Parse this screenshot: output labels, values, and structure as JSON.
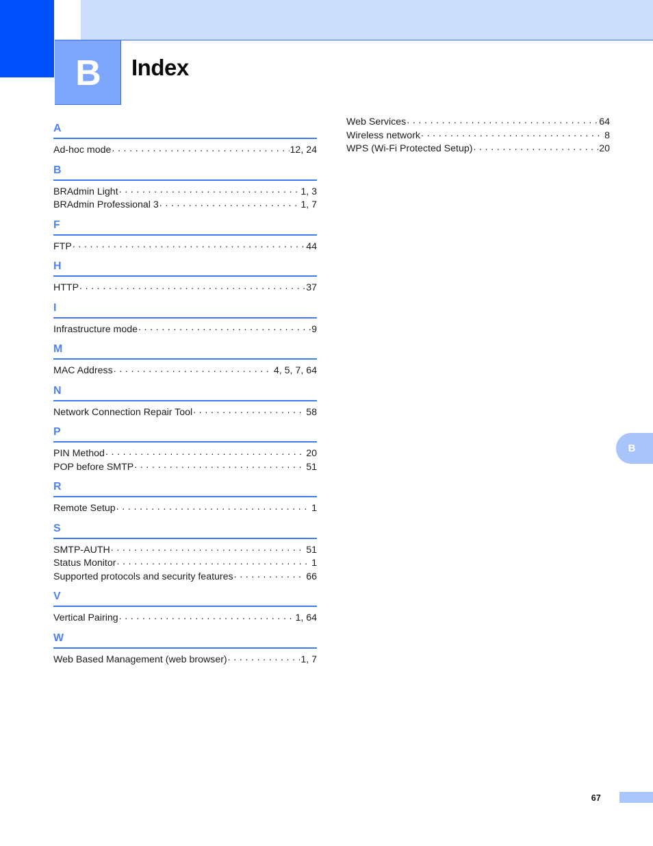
{
  "header": {
    "chapter_letter": "B",
    "title": "Index",
    "colors": {
      "dark_blue": "#0050fc",
      "light_blue": "#ccdcfb",
      "chapter_box_blue": "#7ea7fb",
      "rule_blue": "#3f79f2",
      "letter_blue": "#4d82f3",
      "tab_blue": "#a9c4fb"
    }
  },
  "side_tab": {
    "label": "B"
  },
  "footer": {
    "page_number": "67"
  },
  "columns": {
    "left": [
      {
        "letter": "A",
        "entries": [
          {
            "title": "Ad-hoc mode",
            "pages": "12, 24"
          }
        ]
      },
      {
        "letter": "B",
        "entries": [
          {
            "title": "BRAdmin Light",
            "pages": "1, 3"
          },
          {
            "title": "BRAdmin Professional 3",
            "pages": "1, 7"
          }
        ]
      },
      {
        "letter": "F",
        "entries": [
          {
            "title": "FTP",
            "pages": "44"
          }
        ]
      },
      {
        "letter": "H",
        "entries": [
          {
            "title": "HTTP",
            "pages": "37"
          }
        ]
      },
      {
        "letter": "I",
        "entries": [
          {
            "title": "Infrastructure mode",
            "pages": "9"
          }
        ]
      },
      {
        "letter": "M",
        "entries": [
          {
            "title": "MAC Address",
            "pages": "4, 5, 7, 64"
          }
        ]
      },
      {
        "letter": "N",
        "entries": [
          {
            "title": "Network Connection Repair Tool",
            "pages": "58"
          }
        ]
      },
      {
        "letter": "P",
        "entries": [
          {
            "title": "PIN Method",
            "pages": "20"
          },
          {
            "title": "POP before SMTP",
            "pages": "51"
          }
        ]
      },
      {
        "letter": "R",
        "entries": [
          {
            "title": "Remote Setup",
            "pages": "1"
          }
        ]
      },
      {
        "letter": "S",
        "entries": [
          {
            "title": "SMTP-AUTH",
            "pages": "51"
          },
          {
            "title": "Status Monitor",
            "pages": "1"
          },
          {
            "title": "Supported protocols and security features",
            "pages": "66"
          }
        ]
      },
      {
        "letter": "V",
        "entries": [
          {
            "title": "Vertical Pairing",
            "pages": "1, 64"
          }
        ]
      },
      {
        "letter": "W",
        "entries": [
          {
            "title": "Web Based Management (web browser)",
            "pages": "1, 7"
          }
        ]
      }
    ],
    "right": [
      {
        "letter": "",
        "continuation": true,
        "entries": [
          {
            "title": "Web Services",
            "pages": "64"
          },
          {
            "title": "Wireless network",
            "pages": "8"
          },
          {
            "title": "WPS (Wi-Fi Protected Setup)",
            "pages": "20"
          }
        ]
      }
    ]
  }
}
